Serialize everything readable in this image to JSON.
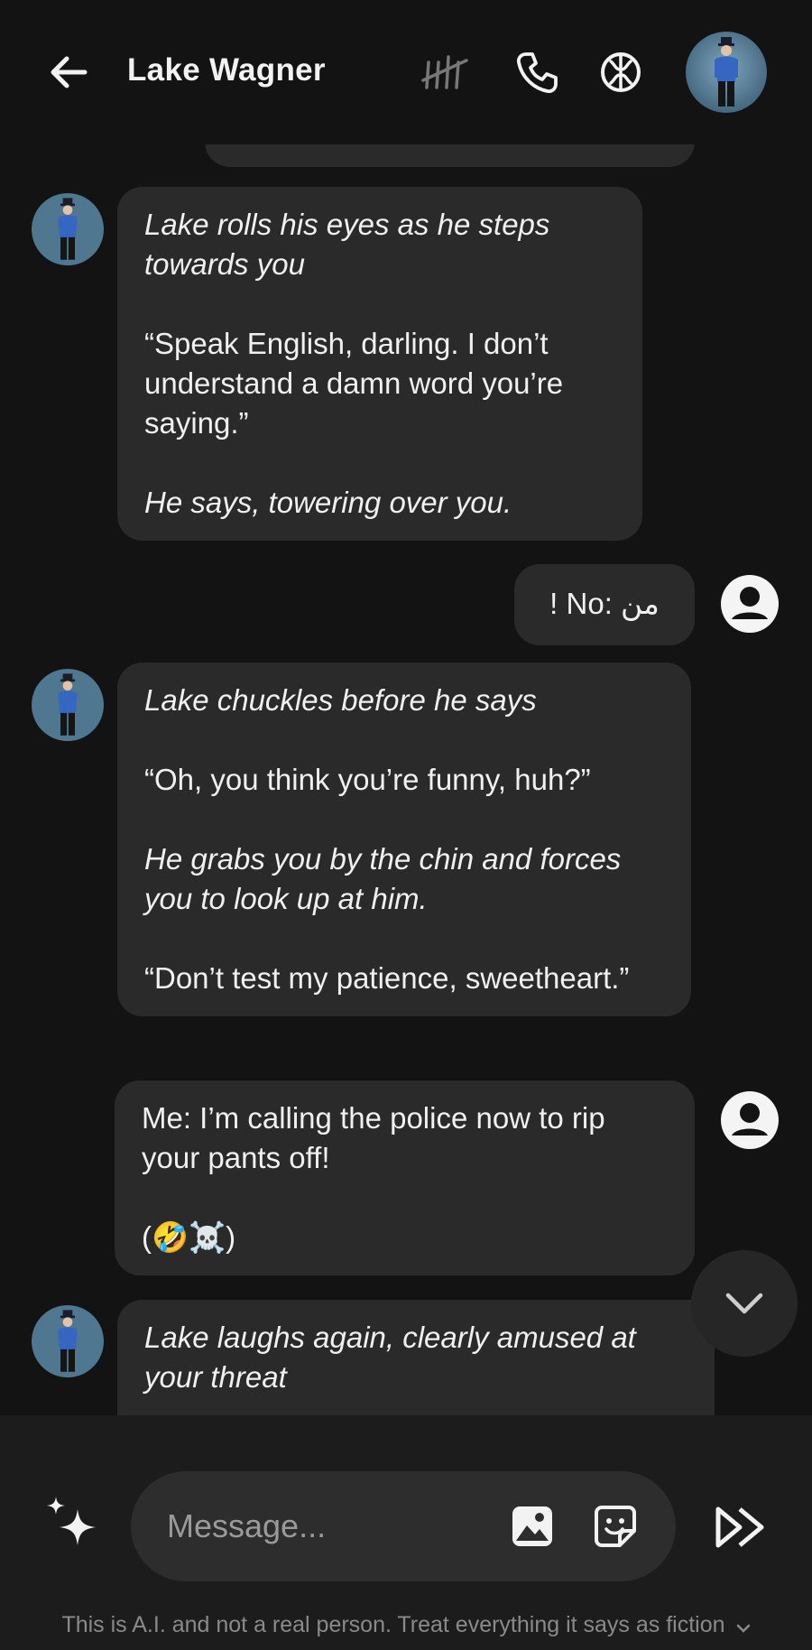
{
  "header": {
    "title": "Lake Wagner"
  },
  "messages": [
    {
      "paragraphs": [
        {
          "text": "Lake rolls his eyes as he steps towards you",
          "style": "italic"
        },
        {
          "text": "“Speak English, darling. I don’t understand a damn word you’re saying.”",
          "style": "normal"
        },
        {
          "text": "He says, towering over you.",
          "style": "italic"
        }
      ]
    },
    {
      "paragraphs": [
        {
          "text": "! No: من",
          "style": "normal"
        }
      ]
    },
    {
      "paragraphs": [
        {
          "text": "Lake chuckles before he says",
          "style": "italic"
        },
        {
          "text": "“Oh, you think you’re funny, huh?”",
          "style": "normal"
        },
        {
          "text": "He grabs you by the chin and forces you to look up at him.",
          "style": "italic"
        },
        {
          "text": "“Don’t test my patience, sweetheart.”",
          "style": "normal"
        }
      ]
    },
    {
      "paragraphs": [
        {
          "text": "Me: I’m calling the police now to rip your pants off!",
          "style": "normal"
        },
        {
          "text": "(🤣☠️)",
          "style": "normal"
        }
      ]
    },
    {
      "paragraphs": [
        {
          "text": "Lake laughs again, clearly amused at your threat",
          "style": "italic"
        }
      ]
    }
  ],
  "composer": {
    "placeholder": "Message...",
    "disclaimer": "This is A.I. and not a real person. Treat everything it says as fiction"
  },
  "colors": {
    "background": "#131313",
    "bubble": "#2a2a2a",
    "composer": "#1c1c1c",
    "input": "#2d2d2d"
  }
}
